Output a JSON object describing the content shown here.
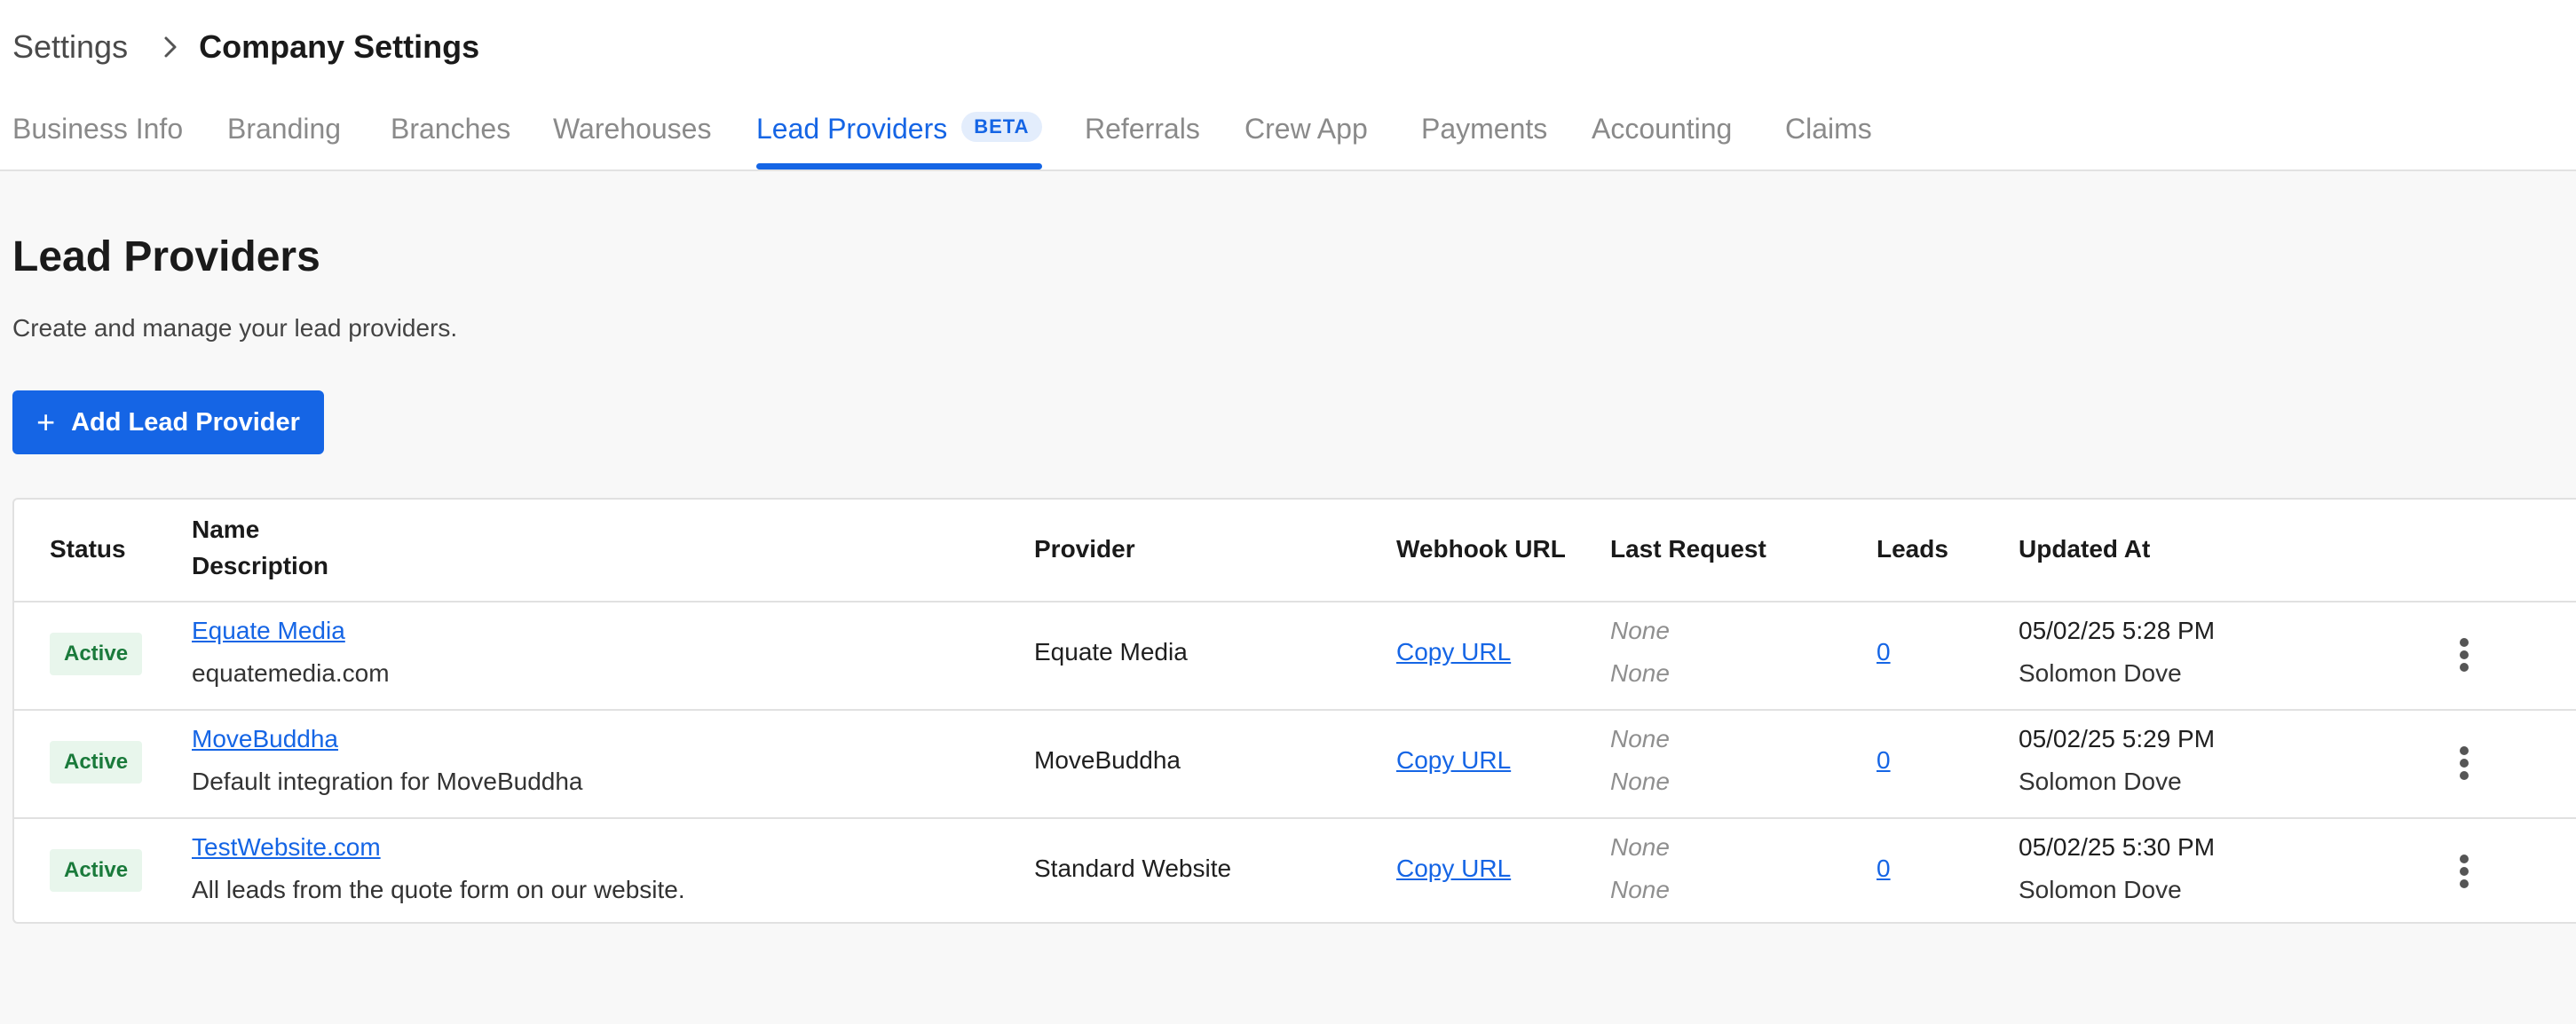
{
  "breadcrumb": {
    "root": "Settings",
    "current": "Company Settings"
  },
  "tabs": [
    {
      "label": "Business Info"
    },
    {
      "label": "Branding"
    },
    {
      "label": "Branches"
    },
    {
      "label": "Warehouses"
    },
    {
      "label": "Lead Providers",
      "badge": "BETA",
      "active": true
    },
    {
      "label": "Referrals"
    },
    {
      "label": "Crew App"
    },
    {
      "label": "Payments"
    },
    {
      "label": "Accounting"
    },
    {
      "label": "Claims"
    }
  ],
  "page": {
    "title": "Lead Providers",
    "subtitle": "Create and manage your lead providers.",
    "add_button_label": "Add Lead Provider"
  },
  "table": {
    "headers": {
      "status": "Status",
      "name": "Name",
      "description": "Description",
      "provider": "Provider",
      "webhook": "Webhook URL",
      "last_request": "Last Request",
      "leads": "Leads",
      "updated": "Updated At"
    },
    "rows": [
      {
        "status": "Active",
        "name": "Equate Media",
        "description": "equatemedia.com",
        "provider": "Equate Media",
        "webhook": "Copy URL",
        "last_request_1": "None",
        "last_request_2": "None",
        "leads": "0",
        "updated_at": "05/02/25 5:28 PM",
        "updated_by": "Solomon Dove"
      },
      {
        "status": "Active",
        "name": "MoveBuddha",
        "description": "Default integration for MoveBuddha",
        "provider": "MoveBuddha",
        "webhook": "Copy URL",
        "last_request_1": "None",
        "last_request_2": "None",
        "leads": "0",
        "updated_at": "05/02/25 5:29 PM",
        "updated_by": "Solomon Dove"
      },
      {
        "status": "Active",
        "name": "TestWebsite.com",
        "description": "All leads from the quote form on our website.",
        "provider": "Standard Website",
        "webhook": "Copy URL",
        "last_request_1": "None",
        "last_request_2": "None",
        "leads": "0",
        "updated_at": "05/02/25 5:30 PM",
        "updated_by": "Solomon Dove"
      }
    ]
  },
  "icons": {
    "breadcrumb_separator": "chevron-right-icon",
    "add": "plus-icon",
    "row_menu": "more-vertical-icon"
  },
  "colors": {
    "accent": "#1565e5",
    "status_active_bg": "#e8f6ec",
    "status_active_text": "#1a7a3b",
    "background": "#f8f8f8"
  }
}
